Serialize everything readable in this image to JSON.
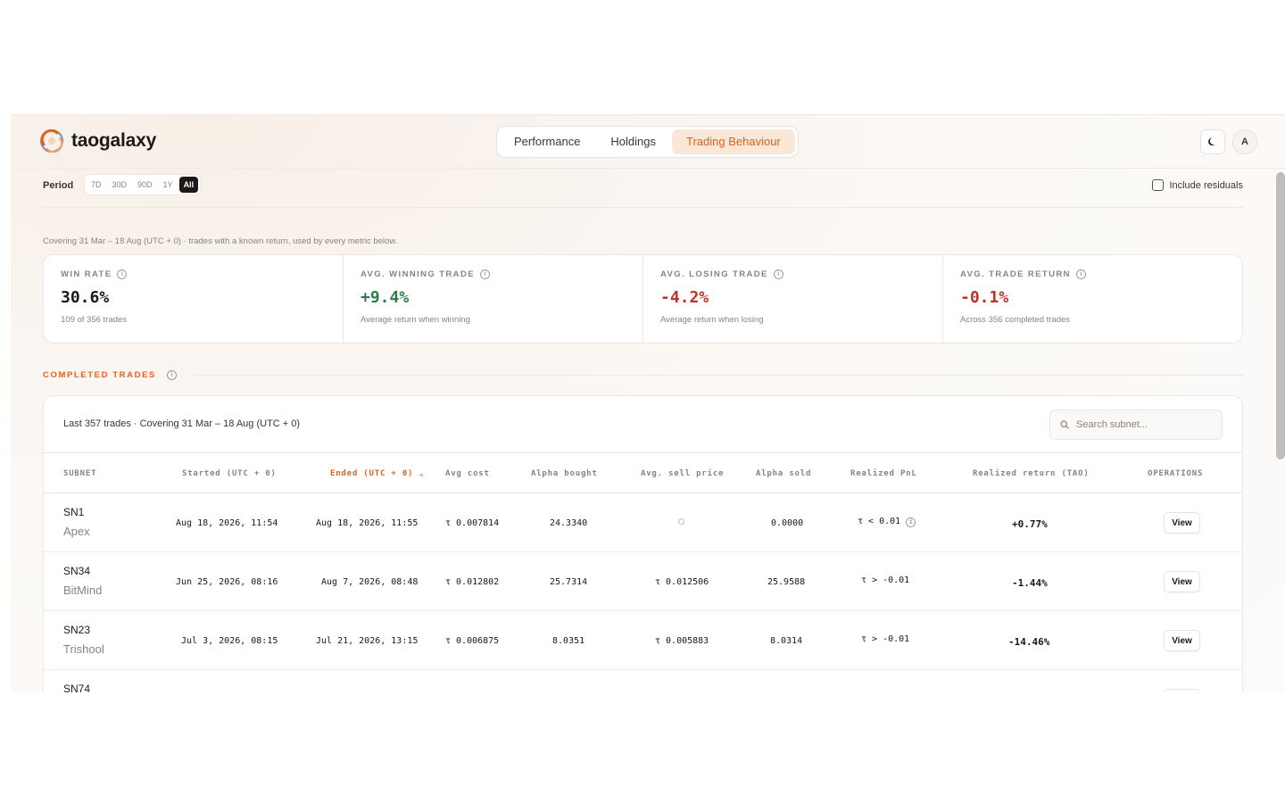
{
  "app": {
    "name": "taogalaxy"
  },
  "nav": {
    "tabs": [
      "Performance",
      "Holdings",
      "Trading Behaviour"
    ],
    "active_tab": "Trading Behaviour"
  },
  "header": {
    "avatar_initial": "A",
    "theme_icon": "moon-icon"
  },
  "period": {
    "label": "Period",
    "options": [
      "7D",
      "30D",
      "90D",
      "1Y",
      "All"
    ],
    "selected": "All",
    "include_residuals_label": "Include residuals",
    "include_residuals_checked": false
  },
  "summary": {
    "covering_text": "Covering 31 Mar – 18 Aug (UTC + 0) · trades with a known return, used by every metric below.",
    "cards": [
      {
        "label": "WIN RATE",
        "value": "30.6%",
        "sub": "109 of 356 trades",
        "tone": "neutral"
      },
      {
        "label": "AVG. WINNING TRADE",
        "value": "+9.4%",
        "sub": "Average return when winning",
        "tone": "positive"
      },
      {
        "label": "AVG. LOSING TRADE",
        "value": "-4.2%",
        "sub": "Average return when losing",
        "tone": "negative"
      },
      {
        "label": "AVG. TRADE RETURN",
        "value": "-0.1%",
        "sub": "Across 356 completed trades",
        "tone": "negative"
      }
    ]
  },
  "completed_trades": {
    "title": "COMPLETED TRADES",
    "caption": "Last 357 trades · Covering 31 Mar – 18 Aug (UTC + 0)",
    "search_placeholder": "Search subnet...",
    "columns": [
      "SUBNET",
      "Started (UTC + 0)",
      "Ended (UTC + 0)",
      "Avg cost",
      "Alpha bought",
      "Avg. sell price",
      "Alpha sold",
      "Realized PnL",
      "Realized return (TAO)",
      "OPERATIONS"
    ],
    "sorted_column": "Ended (UTC + 0)",
    "sort_glyph": "⌄",
    "view_label": "View",
    "rows": [
      {
        "id": "SN1",
        "name": "Apex",
        "started": "Aug 18, 2026, 11:54",
        "ended": "Aug 18, 2026, 11:55",
        "avg_cost": "τ 0.007814",
        "alpha_bought": "24.3340",
        "avg_sell": "",
        "alpha_sold": "0.0000",
        "pnl": "τ < 0.01",
        "ret": "+0.77%",
        "tone": "positive"
      },
      {
        "id": "SN34",
        "name": "BitMind",
        "started": "Jun 25, 2026, 08:16",
        "ended": "Aug 7, 2026, 08:48",
        "avg_cost": "τ 0.012802",
        "alpha_bought": "25.7314",
        "avg_sell": "τ 0.012506",
        "alpha_sold": "25.9588",
        "pnl": "τ > -0.01",
        "ret": "-1.44%",
        "tone": "negative"
      },
      {
        "id": "SN23",
        "name": "Trishool",
        "started": "Jul 3, 2026, 08:15",
        "ended": "Jul 21, 2026, 13:15",
        "avg_cost": "τ 0.006875",
        "alpha_bought": "8.0351",
        "avg_sell": "τ 0.005883",
        "alpha_sold": "8.0314",
        "pnl": "τ > -0.01",
        "ret": "-14.46%",
        "tone": "negative"
      },
      {
        "id": "SN74",
        "name": "",
        "started": "",
        "ended": "",
        "avg_cost": "",
        "alpha_bought": "",
        "avg_sell": "",
        "alpha_sold": "",
        "pnl": "",
        "ret": "",
        "tone": "neutral"
      }
    ]
  },
  "colors": {
    "accent": "#e0621d",
    "accent_bg": "#fbe7d7",
    "positive": "#2e7d4a",
    "negative": "#c0322b",
    "muted": "#8a837d"
  }
}
